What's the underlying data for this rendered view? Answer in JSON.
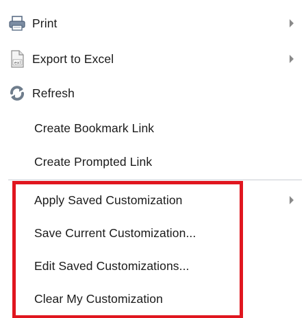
{
  "menu": {
    "items": [
      {
        "label": "Print",
        "icon": "printer-icon",
        "has_submenu": true
      },
      {
        "label": "Export to Excel",
        "icon": "excel-file-icon",
        "has_submenu": true
      },
      {
        "label": "Refresh",
        "icon": "refresh-icon",
        "has_submenu": false
      },
      {
        "label": "Create Bookmark Link",
        "has_submenu": false
      },
      {
        "label": "Create Prompted Link",
        "has_submenu": false
      },
      {
        "label": "Apply Saved Customization",
        "has_submenu": true
      },
      {
        "label": "Save Current Customization...",
        "has_submenu": false
      },
      {
        "label": "Edit Saved Customizations...",
        "has_submenu": false
      },
      {
        "label": "Clear My Customization",
        "has_submenu": false
      }
    ]
  },
  "colors": {
    "highlight_border": "#e0161f",
    "submenu_arrow": "#8a8a8a",
    "divider": "#c9cdd4",
    "text": "#1a1a1a"
  }
}
